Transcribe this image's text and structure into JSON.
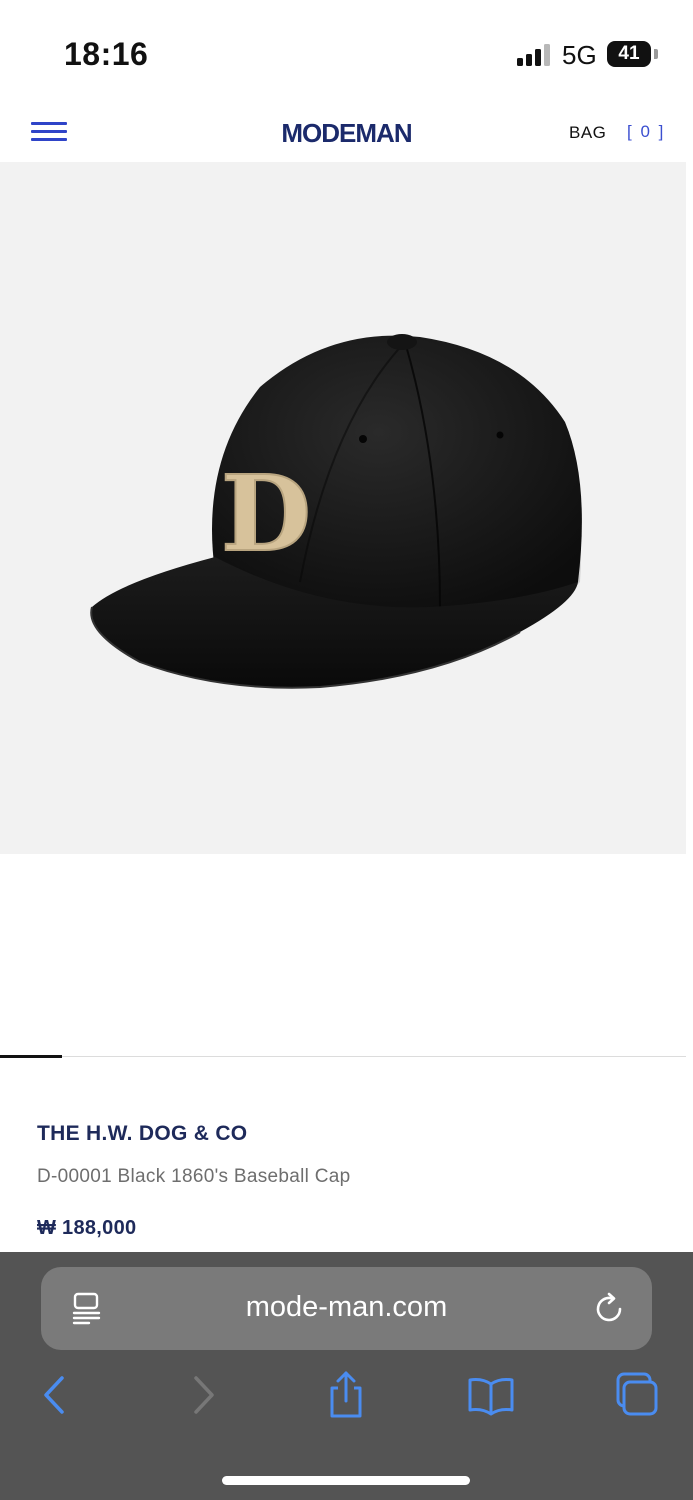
{
  "status_bar": {
    "time": "18:16",
    "network": "5G",
    "battery": "41"
  },
  "header": {
    "logo": "MODEMAN",
    "bag_label": "BAG",
    "bag_count": "[ 0 ]"
  },
  "product": {
    "image_badge_letter": "D",
    "brand": "THE H.W. DOG & CO",
    "name": "D-00001 Black 1860's Baseball Cap",
    "price": "₩ 188,000",
    "gallery_progress": 0.09
  },
  "browser": {
    "url": "mode-man.com"
  },
  "icons": {
    "menu": "hamburger-menu-icon",
    "page": "page-menu-icon",
    "reload": "reload-icon",
    "back": "back-chevron-icon",
    "forward": "forward-chevron-icon",
    "share": "share-icon",
    "bookmarks": "bookmarks-icon",
    "tabs": "tabs-icon"
  },
  "colors": {
    "accent": "#2f44c8",
    "brand_navy": "#1e2a5a",
    "toolbar": "#545454",
    "ios_blue": "#4a8cf0"
  }
}
